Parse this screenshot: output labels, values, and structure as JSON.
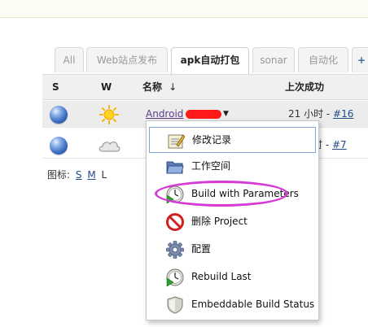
{
  "tabs": [
    {
      "label": "All",
      "active": false
    },
    {
      "label": "Web站点发布",
      "active": false
    },
    {
      "label": "apk自动打包",
      "active": true
    },
    {
      "label": "sonar",
      "active": false
    },
    {
      "label": "自动化",
      "active": false
    },
    {
      "label": "+",
      "active": false
    }
  ],
  "table": {
    "headers": {
      "s": "S",
      "w": "W",
      "name": "名称",
      "sort": "↓",
      "last_success": "上次成功"
    },
    "rows": [
      {
        "name": "Android",
        "last_success_text": "21 小时 - ",
        "build_link": "#16",
        "weather": "sunny-icon"
      },
      {
        "name": "",
        "last_success_text": "时 - ",
        "build_link": "#7",
        "weather": "cloudy-icon"
      }
    ]
  },
  "legend": {
    "label": "图标:",
    "s": "S",
    "m": "M",
    "l": "L"
  },
  "menu": {
    "items": [
      {
        "label": "修改记录",
        "icon": "notepad-icon"
      },
      {
        "label": "工作空间",
        "icon": "folder-icon"
      },
      {
        "label": "Build with Parameters",
        "icon": "clock-play-icon"
      },
      {
        "label": "删除 Project",
        "icon": "no-entry-icon"
      },
      {
        "label": "配置",
        "icon": "gear-icon"
      },
      {
        "label": "Rebuild Last",
        "icon": "clock-play-icon"
      },
      {
        "label": "Embeddable Build Status",
        "icon": "shield-icon"
      }
    ]
  },
  "colors": {
    "annotation": "#d63ad4",
    "link": "#204a87",
    "redaction": "#ff1a1a"
  }
}
